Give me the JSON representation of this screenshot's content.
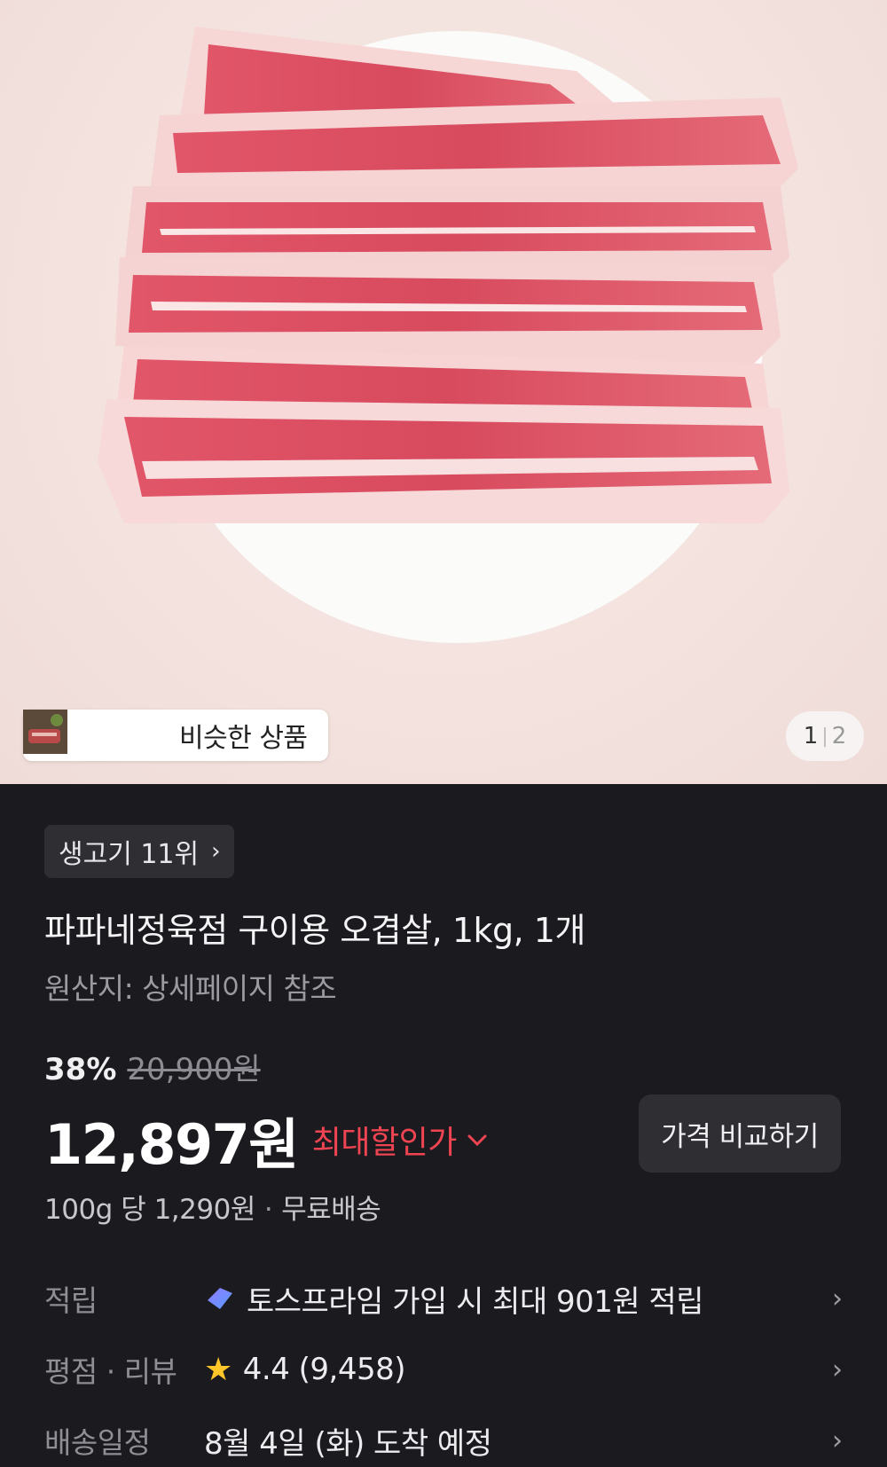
{
  "hero": {
    "similar_label": "비슷한 상품",
    "pager_current": "1",
    "pager_sep": "|",
    "pager_total": "2"
  },
  "product": {
    "rank_badge": "생고기 11위",
    "title": "파파네정육점 구이용 오겹살, 1kg, 1개",
    "origin": "원산지: 상세페이지 참조"
  },
  "pricing": {
    "discount_rate": "38%",
    "original_price": "20,900원",
    "price": "12,897원",
    "max_discount_label": "최대할인가",
    "compare_button": "가격 비교하기",
    "unit_price": "100g 당 1,290원",
    "shipping": "무료배송"
  },
  "info": {
    "reward_label": "적립",
    "reward_value": "토스프라임 가입 시 최대 901원 적립",
    "rating_label": "평점 · 리뷰",
    "rating_value": "4.4 (9,458)",
    "delivery_label": "배송일정",
    "delivery_value": "8월 4일 (화) 도착 예정"
  },
  "colors": {
    "background": "#1b1b1f",
    "accent_red": "#f04452",
    "star": "#ffc629"
  },
  "icons": [
    "chevron-right-icon",
    "chevron-down-icon",
    "star-icon",
    "toss-prime-icon"
  ]
}
